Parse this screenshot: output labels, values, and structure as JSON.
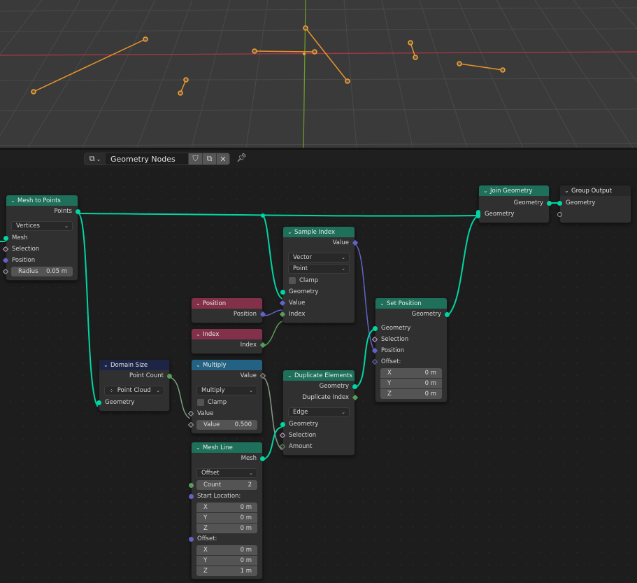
{
  "viewport": {
    "name": "3D Viewport",
    "axis_colors": {
      "x": "#a83845",
      "y": "#6a9a2a"
    },
    "edge_color": "#e8942c",
    "vertex_color": "#f0a030",
    "mesh_lines_count": 6
  },
  "header": {
    "editor_type_icon": "node-editor-icon",
    "node_group_name": "Geometry Nodes",
    "fake_user_icon": "shield-icon",
    "duplicate_icon": "duplicate-icon",
    "unlink_icon": "close-icon",
    "pin_icon": "pin-icon"
  },
  "colors": {
    "geometry_socket": "#00d6a3",
    "vector_socket": "#6363c7",
    "integer_socket": "#5a9b5a",
    "float_socket": "#a1a1a1",
    "header_geometry": "#1e705a",
    "header_input": "#83314a",
    "header_converter": "#246283",
    "header_attribute": "#1d2546"
  },
  "nodes": {
    "mesh_to_points": {
      "title": "Mesh to Points",
      "output_points": "Points",
      "mode": "Vertices",
      "input_mesh": "Mesh",
      "input_selection": "Selection",
      "input_position": "Position",
      "radius_label": "Radius",
      "radius_value": "0.05 m"
    },
    "sample_index": {
      "title": "Sample Index",
      "output_value": "Value",
      "data_type": "Vector",
      "domain": "Point",
      "clamp_label": "Clamp",
      "clamp_checked": false,
      "input_geometry": "Geometry",
      "input_value": "Value",
      "input_index": "Index"
    },
    "position": {
      "title": "Position",
      "output": "Position"
    },
    "index": {
      "title": "Index",
      "output": "Index"
    },
    "domain_size": {
      "title": "Domain Size",
      "output_point_count": "Point Count",
      "component": "Point Cloud",
      "input_geometry": "Geometry"
    },
    "multiply": {
      "title": "Multiply",
      "output_value": "Value",
      "operation": "Multiply",
      "clamp_label": "Clamp",
      "clamp_checked": false,
      "input_value": "Value",
      "value_label": "Value",
      "value_value": "0.500"
    },
    "mesh_line": {
      "title": "Mesh Line",
      "output_mesh": "Mesh",
      "mode": "Offset",
      "count_label": "Count",
      "count_value": "2",
      "start_location_label": "Start Location:",
      "start_x": {
        "label": "X",
        "value": "0 m"
      },
      "start_y": {
        "label": "Y",
        "value": "0 m"
      },
      "start_z": {
        "label": "Z",
        "value": "0 m"
      },
      "offset_label": "Offset:",
      "offset_x": {
        "label": "X",
        "value": "0 m"
      },
      "offset_y": {
        "label": "Y",
        "value": "0 m"
      },
      "offset_z": {
        "label": "Z",
        "value": "1 m"
      }
    },
    "duplicate_elements": {
      "title": "Duplicate Elements",
      "output_geometry": "Geometry",
      "output_duplicate_index": "Duplicate Index",
      "domain": "Edge",
      "input_geometry": "Geometry",
      "input_selection": "Selection",
      "input_amount": "Amount"
    },
    "set_position": {
      "title": "Set Position",
      "output_geometry": "Geometry",
      "input_geometry": "Geometry",
      "input_selection": "Selection",
      "input_position": "Position",
      "offset_label": "Offset:",
      "offset_x": {
        "label": "X",
        "value": "0 m"
      },
      "offset_y": {
        "label": "Y",
        "value": "0 m"
      },
      "offset_z": {
        "label": "Z",
        "value": "0 m"
      }
    },
    "join_geometry": {
      "title": "Join Geometry",
      "output_geometry": "Geometry",
      "input_geometry": "Geometry"
    },
    "group_output": {
      "title": "Group Output",
      "input_geometry": "Geometry"
    }
  }
}
